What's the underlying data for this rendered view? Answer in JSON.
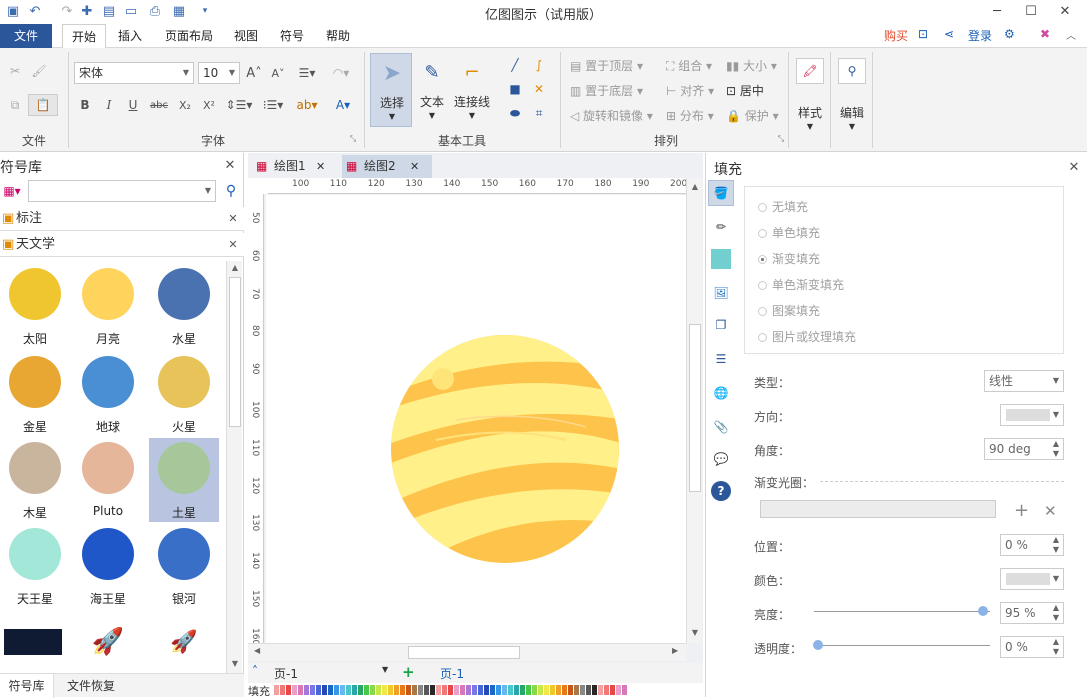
{
  "window": {
    "title": "亿图图示（试用版）"
  },
  "menu": {
    "file": "文件",
    "home": "开始",
    "insert": "插入",
    "layout": "页面布局",
    "view": "视图",
    "symbol": "符号",
    "help": "帮助",
    "buy": "购买",
    "login": "登录"
  },
  "ribbon": {
    "font_name": "宋体",
    "font_size": "10",
    "select": "选择",
    "text": "文本",
    "connector": "连接线",
    "bring_front": "置于顶层",
    "send_back": "置于底层",
    "rotate_mirror": "旋转和镜像",
    "group": "组合",
    "align": "对齐",
    "distribute": "分布",
    "size": "大小",
    "center": "居中",
    "protect": "保护",
    "style": "样式",
    "edit": "编辑",
    "groups": {
      "file": "文件",
      "font": "字体",
      "basic_tools": "基本工具",
      "arrange": "排列"
    }
  },
  "library": {
    "title": "符号库",
    "categories": [
      "标注",
      "天文学"
    ],
    "symbols": [
      {
        "name": "太阳",
        "color": "#f0c630"
      },
      {
        "name": "月亮",
        "color": "#ffd45c"
      },
      {
        "name": "水星",
        "color": "#4b72b0"
      },
      {
        "name": "金星",
        "color": "#e8a732"
      },
      {
        "name": "地球",
        "color": "#4a8fd4"
      },
      {
        "name": "火星",
        "color": "#e8c35a"
      },
      {
        "name": "木星",
        "color": "#c9b59e"
      },
      {
        "name": "Pluto",
        "color": "#e6b69a"
      },
      {
        "name": "土星",
        "color": "#a7c69a"
      },
      {
        "name": "天王星",
        "color": "#a3e7d8"
      },
      {
        "name": "海王星",
        "color": "#1f57c9"
      },
      {
        "name": "银河",
        "color": "#3a6fc8"
      }
    ],
    "bottom_tabs": [
      "符号库",
      "文件恢复"
    ]
  },
  "document_tabs": [
    "绘图1",
    "绘图2"
  ],
  "ruler": {
    "h": [
      "100",
      "110",
      "120",
      "130",
      "140",
      "150",
      "160",
      "170",
      "180",
      "190",
      "200"
    ],
    "v": [
      "50",
      "60",
      "70",
      "80",
      "90",
      "100",
      "110",
      "120",
      "130",
      "140",
      "150",
      "160"
    ]
  },
  "page_nav": {
    "current": "页-1",
    "tab": "页-1"
  },
  "colorbar_label": "填充",
  "fill_panel": {
    "title": "填充",
    "options": [
      "无填充",
      "单色填充",
      "渐变填充",
      "单色渐变填充",
      "图案填充",
      "图片或纹理填充"
    ],
    "selected": "渐变填充",
    "type_label": "类型：",
    "type_value": "线性",
    "direction_label": "方向：",
    "angle_label": "角度：",
    "angle_value": "90 deg",
    "stops_label": "渐变光圈：",
    "position_label": "位置：",
    "position_value": "0 %",
    "color_label": "颜色：",
    "brightness_label": "亮度：",
    "brightness_value": "95 %",
    "transparency_label": "透明度：",
    "transparency_value": "0 %"
  },
  "colors": {
    "accent": "#2b579a",
    "buy": "#e04b2d",
    "link": "#1a5fb4"
  }
}
